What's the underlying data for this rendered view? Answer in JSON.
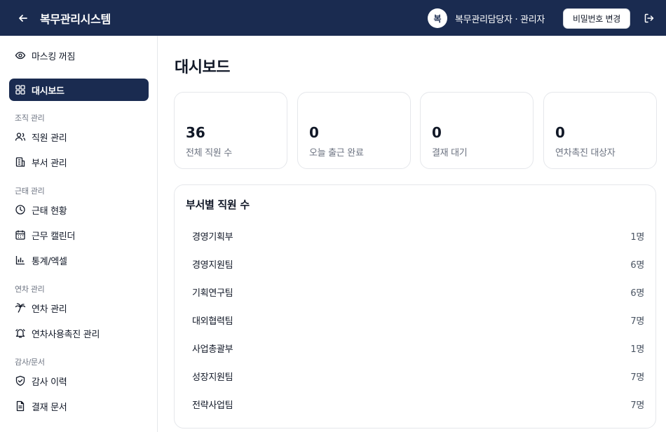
{
  "header": {
    "title": "복무관리시스템",
    "avatar_initial": "복",
    "user_label": "복무관리담당자 · 관리자",
    "password_button": "비밀번호 변경"
  },
  "sidebar": {
    "masking_label": "마스킹 꺼짐",
    "dashboard_label": "대시보드",
    "sections": [
      {
        "title": "조직 관리",
        "items": [
          "직원 관리",
          "부서 관리"
        ]
      },
      {
        "title": "근태 관리",
        "items": [
          "근태 현황",
          "근무 캘린더",
          "통계/엑셀"
        ]
      },
      {
        "title": "연차 관리",
        "items": [
          "연차 관리",
          "연차사용촉진 관리"
        ]
      },
      {
        "title": "감사/문서",
        "items": [
          "감사 이력",
          "결재 문서"
        ]
      }
    ]
  },
  "main": {
    "page_title": "대시보드",
    "stats": [
      {
        "value": "36",
        "label": "전체 직원 수"
      },
      {
        "value": "0",
        "label": "오늘 출근 완료"
      },
      {
        "value": "0",
        "label": "결재 대기"
      },
      {
        "value": "0",
        "label": "연차촉진 대상자"
      }
    ],
    "dept_panel": {
      "title": "부서별 직원 수",
      "rows": [
        {
          "name": "경영기획부",
          "count": "1명"
        },
        {
          "name": "경영지원팀",
          "count": "6명"
        },
        {
          "name": "기획연구팀",
          "count": "6명"
        },
        {
          "name": "대외협력팀",
          "count": "7명"
        },
        {
          "name": "사업총괄부",
          "count": "1명"
        },
        {
          "name": "성장지원팀",
          "count": "7명"
        },
        {
          "name": "전략사업팀",
          "count": "7명"
        }
      ]
    }
  },
  "colors": {
    "navy": "#1a2b50",
    "border": "#e5e7eb",
    "muted_text": "#6b7280"
  }
}
